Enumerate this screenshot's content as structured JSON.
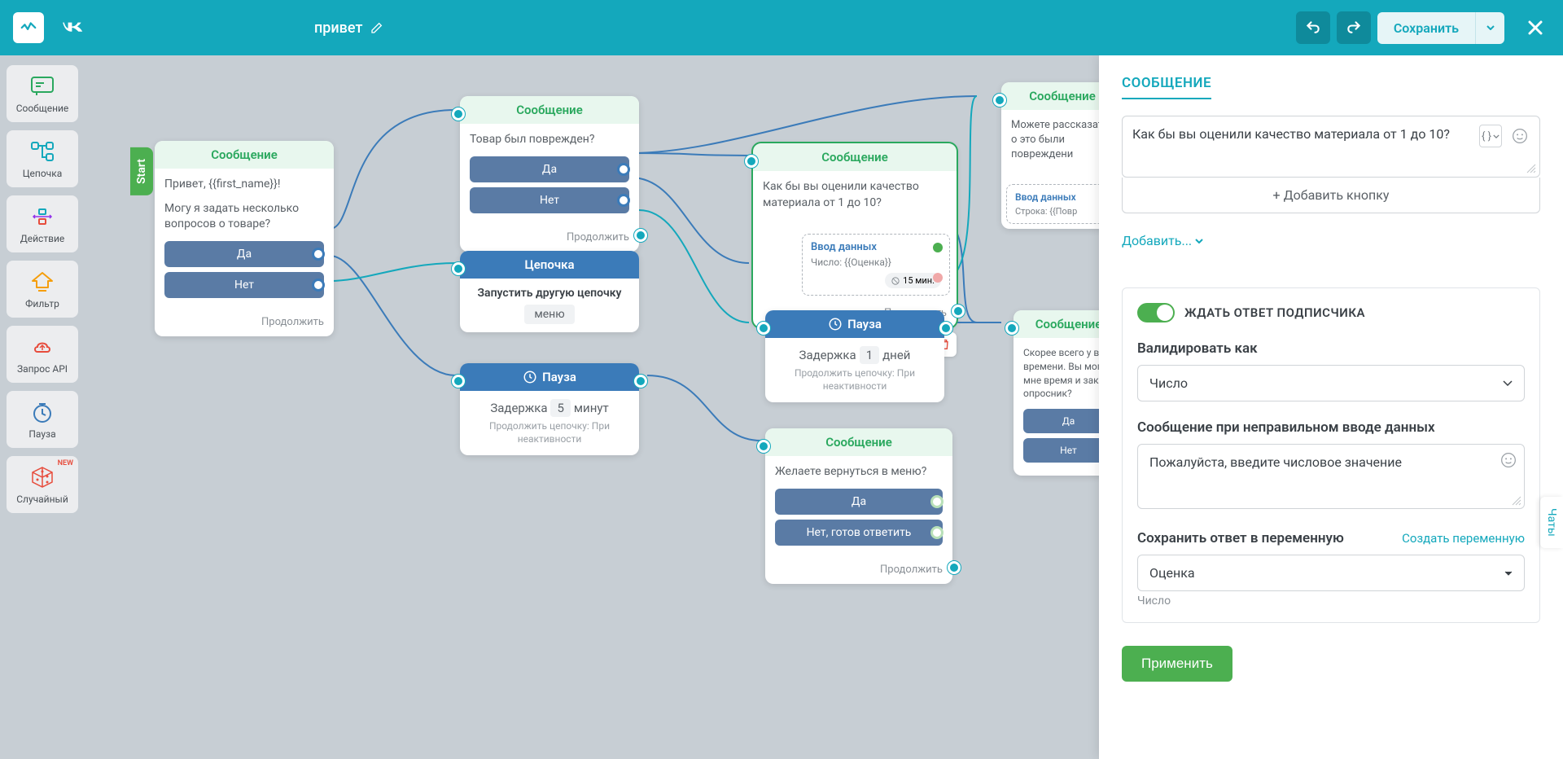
{
  "header": {
    "flow_title": "привет",
    "save": "Сохранить"
  },
  "sidebar": {
    "items": [
      {
        "label": "Сообщение"
      },
      {
        "label": "Цепочка"
      },
      {
        "label": "Действие"
      },
      {
        "label": "Фильтр"
      },
      {
        "label": "Запрос API"
      },
      {
        "label": "Пауза"
      },
      {
        "label": "Случайный",
        "badge": "NEW"
      }
    ]
  },
  "nodes": {
    "start_tab": "Start",
    "continue": "Продолжить",
    "n1": {
      "title": "Сообщение",
      "text1": "Привет, {{first_name}}!",
      "text2": "Могу я задать несколько вопросов о товаре?",
      "btn_yes": "Да",
      "btn_no": "Нет"
    },
    "n2": {
      "title": "Сообщение",
      "text": "Товар был поврежден?",
      "btn_yes": "Да",
      "btn_no": "Нет"
    },
    "n3": {
      "title": "Цепочка",
      "text": "Запустить другую цепочку",
      "menu": "меню"
    },
    "n4": {
      "title": "Пауза",
      "delay_label": "Задержка",
      "delay_value": "5",
      "delay_unit": "минут",
      "sub": "Продолжить цепочку: При неактивности"
    },
    "n5": {
      "title": "Сообщение",
      "text": "Как бы вы оценили качество материала от 1 до 10?",
      "input_title": "Ввод данных",
      "input_sub": "Число: {{Оценка}}",
      "timeout": "15 мин."
    },
    "n6": {
      "title": "Пауза",
      "delay_label": "Задержка",
      "delay_value": "1",
      "delay_unit": "дней",
      "sub": "Продолжить цепочку: При неактивности"
    },
    "n7": {
      "title": "Сообщение",
      "text": "Желаете вернуться в меню?",
      "btn_yes": "Да",
      "btn_no": "Нет, готов ответить"
    },
    "n8": {
      "title": "Сообщение",
      "text": "Можете рассказать о это были повреждени",
      "input_title": "Ввод данных",
      "input_sub": "Строка: {{Повр"
    },
    "n9": {
      "title": "Сообщение",
      "text": "Скорее всего у вас времени. Вы могл мне время и зако опросник?",
      "btn_yes": "Да",
      "btn_no": "Нет"
    }
  },
  "panel": {
    "title": "СООБЩЕНИЕ",
    "message_text": "Как бы вы оценили качество материала от 1 до 10?",
    "add_button": "+ Добавить кнопку",
    "add_link": "Добавить...",
    "wait_label": "ЖДАТЬ ОТВЕТ ПОДПИСЧИКА",
    "validate_label": "Валидировать как",
    "validate_value": "Число",
    "error_msg_label": "Сообщение при неправильном вводе данных",
    "error_msg_value": "Пожалуйста, введите числовое значение",
    "save_var_label": "Сохранить ответ в переменную",
    "create_var": "Создать переменную",
    "var_value": "Оценка",
    "var_type": "Число",
    "apply": "Применить"
  },
  "chats_tab": "Чаты"
}
